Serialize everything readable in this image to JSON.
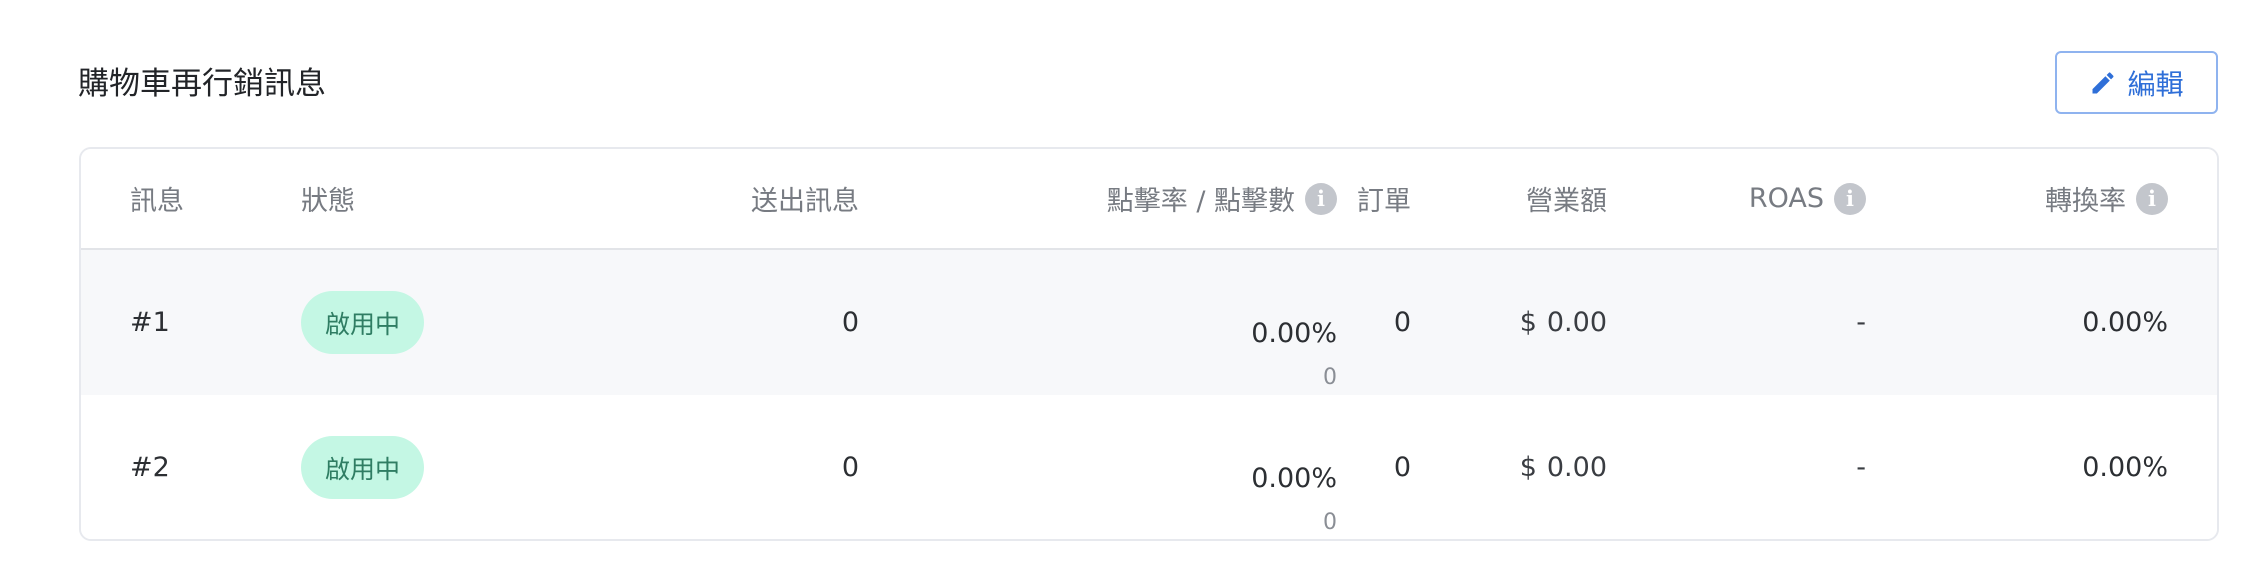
{
  "section": {
    "title": "購物車再行銷訊息",
    "edit_label": "編輯"
  },
  "table": {
    "headers": {
      "message": "訊息",
      "status": "狀態",
      "sent": "送出訊息",
      "ctr": "點擊率 / 點擊數",
      "orders": "訂單",
      "revenue": "營業額",
      "roas": "ROAS",
      "conversion": "轉換率"
    },
    "rows": [
      {
        "message": "#1",
        "status": "啟用中",
        "sent": "0",
        "ctr": "0.00%",
        "clicks": "0",
        "orders": "0",
        "currency": "$",
        "revenue": "0.00",
        "roas": "-",
        "conversion": "0.00%"
      },
      {
        "message": "#2",
        "status": "啟用中",
        "sent": "0",
        "ctr": "0.00%",
        "clicks": "0",
        "orders": "0",
        "currency": "$",
        "revenue": "0.00",
        "roas": "-",
        "conversion": "0.00%"
      }
    ]
  },
  "colors": {
    "accent": "#2f6fd8",
    "badge_bg": "#c4f7e4",
    "badge_text": "#2f7d63",
    "row_alt": "#f7f8fa"
  }
}
